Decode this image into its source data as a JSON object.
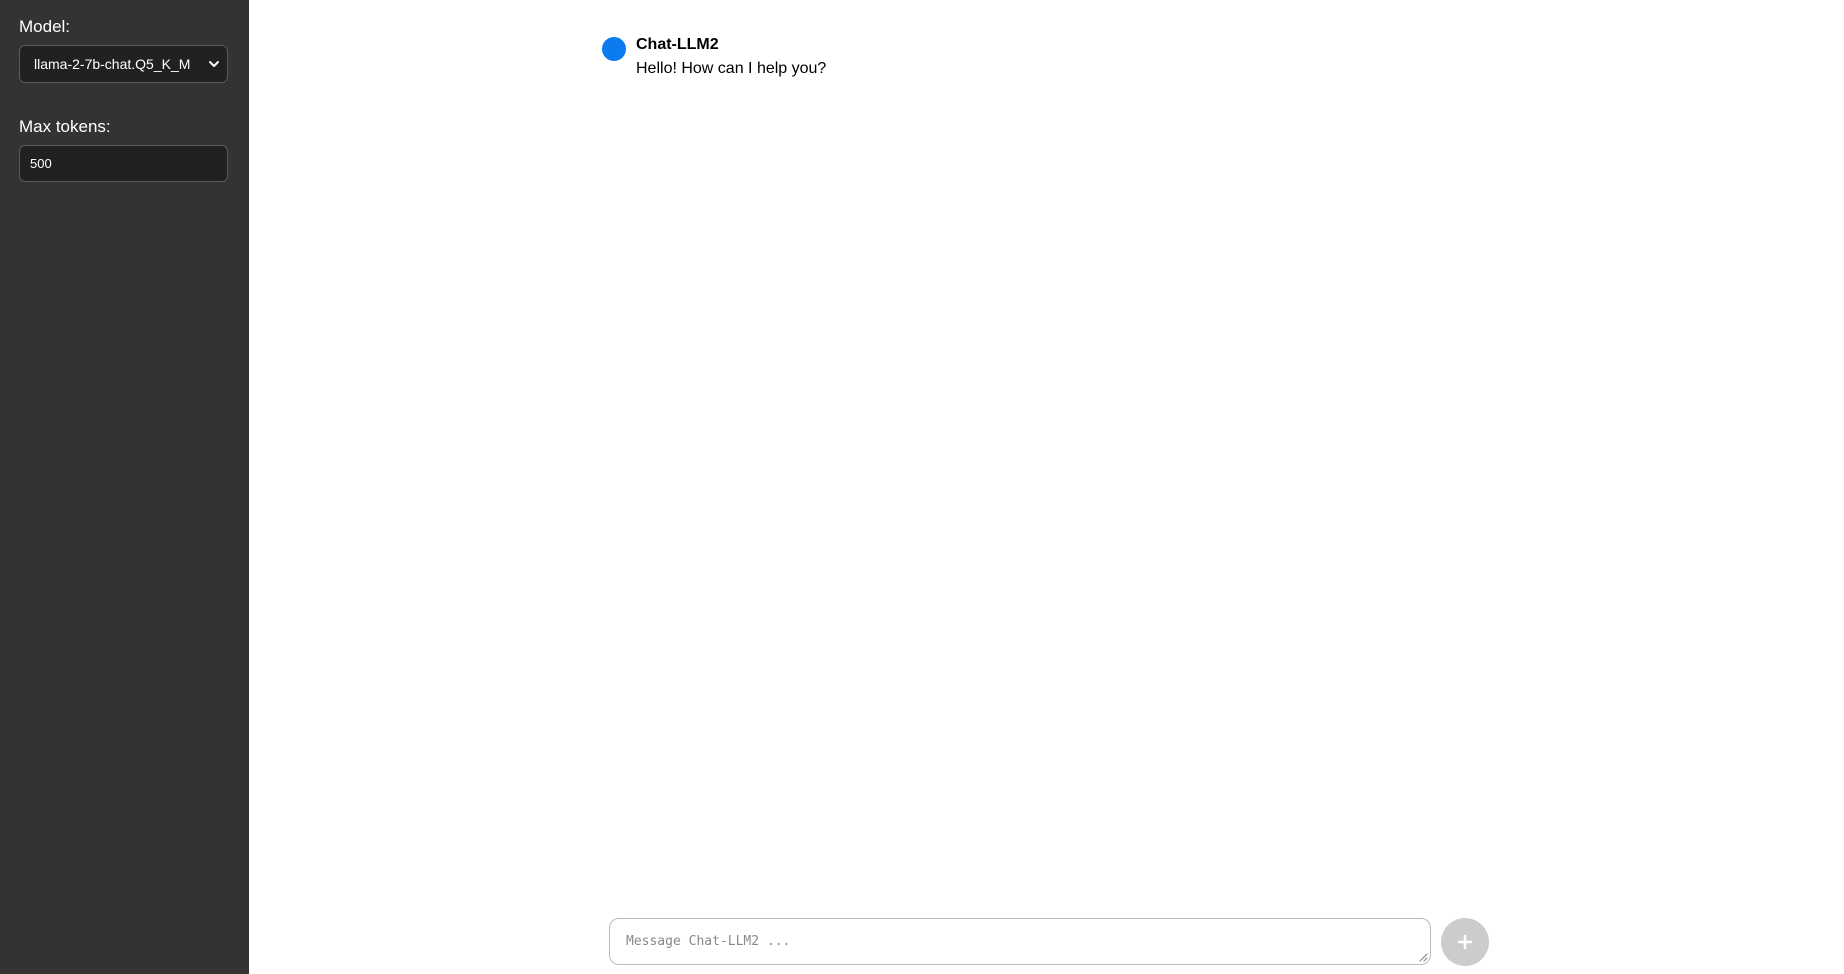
{
  "sidebar": {
    "model_label": "Model:",
    "model_selected": "llama-2-7b-chat.Q5_K_M",
    "max_tokens_label": "Max tokens:",
    "max_tokens_value": "500"
  },
  "chat": {
    "messages": [
      {
        "author": "Chat-LLM2",
        "text": "Hello! How can I help you?",
        "avatar_color": "#0b7bef"
      }
    ]
  },
  "composer": {
    "placeholder": "Message Chat-LLM2 ...",
    "send_icon": "plus-icon"
  },
  "colors": {
    "sidebar_bg": "#333333",
    "accent": "#0b7bef",
    "send_button_bg": "#cccccc"
  }
}
